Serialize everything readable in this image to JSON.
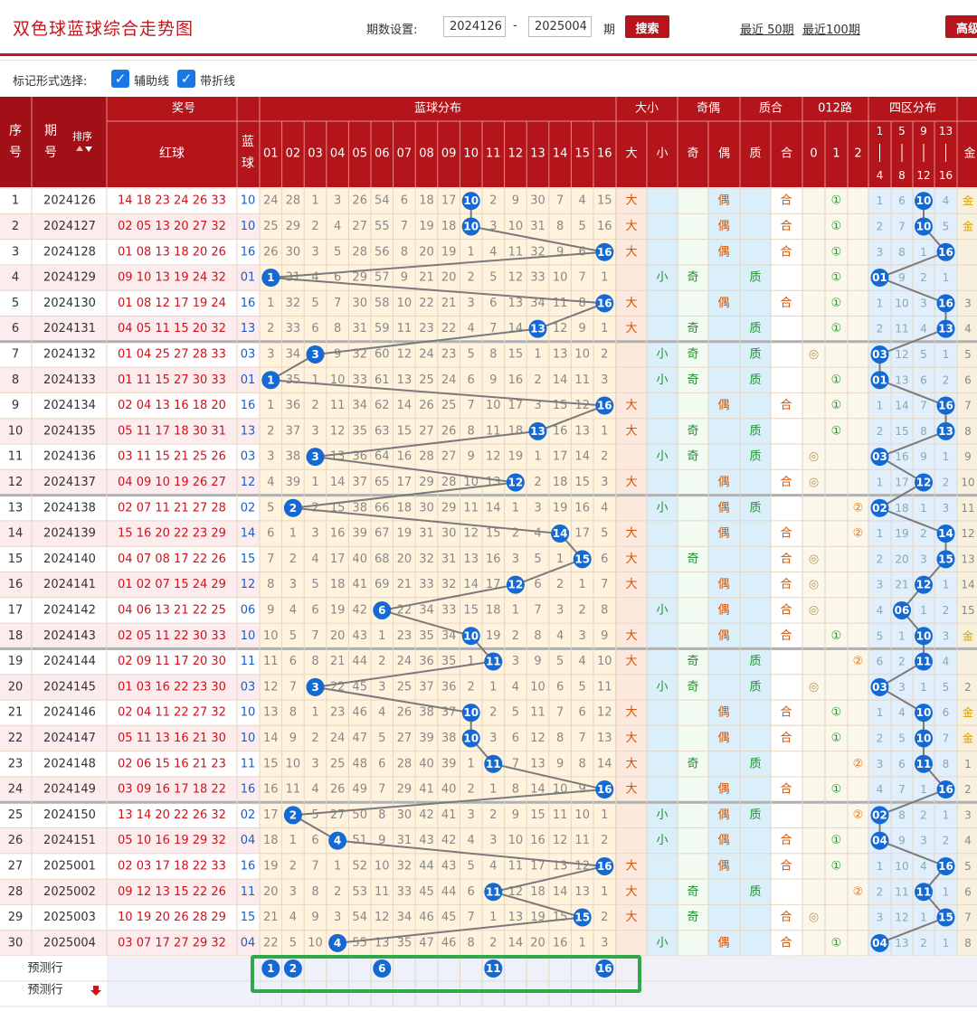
{
  "header": {
    "title": "双色球蓝球综合走势图",
    "period_label": "期数设置:",
    "period_from": "2024126",
    "period_dash": "-",
    "period_to": "2025004",
    "period_unit": "期",
    "search_label": "搜索",
    "recent_50_label": "最近 50期",
    "recent_100_label": "最近100期",
    "advanced_label": "高级"
  },
  "options": {
    "label": "标记形式选择:",
    "aux_line_label": "辅助线",
    "fold_line_label": "带折线",
    "aux_line_checked": true,
    "fold_line_checked": true
  },
  "table": {
    "col_seq": "序号",
    "col_issue": "期号",
    "sort_label": "排序",
    "group_prize": "奖号",
    "col_red": "红球",
    "col_blue": "蓝球",
    "group_blue_dist": "蓝球分布",
    "blue_numbers": [
      "01",
      "02",
      "03",
      "04",
      "05",
      "06",
      "07",
      "08",
      "09",
      "10",
      "11",
      "12",
      "13",
      "14",
      "15",
      "16"
    ],
    "group_size": "大小",
    "size_labels": [
      "大",
      "小"
    ],
    "group_parity": "奇偶",
    "parity_labels": [
      "奇",
      "偶"
    ],
    "group_prime": "质合",
    "prime_labels": [
      "质",
      "合"
    ],
    "group_mod3": "012路",
    "mod3_labels": [
      "0",
      "1",
      "2"
    ],
    "group_zone": "四区分布",
    "zone_labels": [
      "1|4",
      "5|8",
      "9|12",
      "13|16"
    ],
    "col_extra_partial": "金",
    "mod3_marks": [
      "◎",
      "①",
      "②"
    ],
    "rows": [
      {
        "seq": "1",
        "issue": "2024126",
        "red": "14 18 23 24 26 33",
        "blue": "10",
        "dist": [
          24,
          28,
          1,
          3,
          26,
          54,
          6,
          18,
          17,
          0,
          2,
          9,
          30,
          7,
          4,
          15
        ],
        "size": "大",
        "parity": "偶",
        "prime": "合",
        "mod3": 1,
        "zone": [
          1,
          6,
          0,
          4
        ],
        "extra": "金"
      },
      {
        "seq": "2",
        "issue": "2024127",
        "red": "02 05 13 20 27 32",
        "blue": "10",
        "dist": [
          25,
          29,
          2,
          4,
          27,
          55,
          7,
          19,
          18,
          0,
          3,
          10,
          31,
          8,
          5,
          16
        ],
        "size": "大",
        "parity": "偶",
        "prime": "合",
        "mod3": 1,
        "zone": [
          2,
          7,
          0,
          5
        ],
        "extra": "金"
      },
      {
        "seq": "3",
        "issue": "2024128",
        "red": "01 08 13 18 20 26",
        "blue": "16",
        "dist": [
          26,
          30,
          3,
          5,
          28,
          56,
          8,
          20,
          19,
          1,
          4,
          11,
          32,
          9,
          6,
          0
        ],
        "size": "大",
        "parity": "偶",
        "prime": "合",
        "mod3": 1,
        "zone": [
          3,
          8,
          1,
          0
        ],
        "extra": ""
      },
      {
        "seq": "4",
        "issue": "2024129",
        "red": "09 10 13 19 24 32",
        "blue": "01",
        "dist": [
          0,
          31,
          4,
          6,
          29,
          57,
          9,
          21,
          20,
          2,
          5,
          12,
          33,
          10,
          7,
          1
        ],
        "size": "小",
        "parity": "奇",
        "prime": "质",
        "mod3": 1,
        "zone": [
          0,
          9,
          2,
          1
        ],
        "extra": ""
      },
      {
        "seq": "5",
        "issue": "2024130",
        "red": "01 08 12 17 19 24",
        "blue": "16",
        "dist": [
          1,
          32,
          5,
          7,
          30,
          58,
          10,
          22,
          21,
          3,
          6,
          13,
          34,
          11,
          8,
          0
        ],
        "size": "大",
        "parity": "偶",
        "prime": "合",
        "mod3": 1,
        "zone": [
          1,
          10,
          3,
          0
        ],
        "extra": "3"
      },
      {
        "seq": "6",
        "issue": "2024131",
        "red": "04 05 11 15 20 32",
        "blue": "13",
        "dist": [
          2,
          33,
          6,
          8,
          31,
          59,
          11,
          23,
          22,
          4,
          7,
          14,
          0,
          12,
          9,
          1
        ],
        "size": "大",
        "parity": "奇",
        "prime": "质",
        "mod3": 1,
        "zone": [
          2,
          11,
          4,
          0
        ],
        "extra": "4"
      },
      {
        "seq": "7",
        "issue": "2024132",
        "red": "01 04 25 27 28 33",
        "blue": "03",
        "dist": [
          3,
          34,
          0,
          9,
          32,
          60,
          12,
          24,
          23,
          5,
          8,
          15,
          1,
          13,
          10,
          2
        ],
        "size": "小",
        "parity": "奇",
        "prime": "质",
        "mod3": 0,
        "zone": [
          0,
          12,
          5,
          1
        ],
        "extra": "5"
      },
      {
        "seq": "8",
        "issue": "2024133",
        "red": "01 11 15 27 30 33",
        "blue": "01",
        "dist": [
          0,
          35,
          1,
          10,
          33,
          61,
          13,
          25,
          24,
          6,
          9,
          16,
          2,
          14,
          11,
          3
        ],
        "size": "小",
        "parity": "奇",
        "prime": "质",
        "mod3": 1,
        "zone": [
          0,
          13,
          6,
          2
        ],
        "extra": "6"
      },
      {
        "seq": "9",
        "issue": "2024134",
        "red": "02 04 13 16 18 20",
        "blue": "16",
        "dist": [
          1,
          36,
          2,
          11,
          34,
          62,
          14,
          26,
          25,
          7,
          10,
          17,
          3,
          15,
          12,
          0
        ],
        "size": "大",
        "parity": "偶",
        "prime": "合",
        "mod3": 1,
        "zone": [
          1,
          14,
          7,
          0
        ],
        "extra": "7"
      },
      {
        "seq": "10",
        "issue": "2024135",
        "red": "05 11 17 18 30 31",
        "blue": "13",
        "dist": [
          2,
          37,
          3,
          12,
          35,
          63,
          15,
          27,
          26,
          8,
          11,
          18,
          0,
          16,
          13,
          1
        ],
        "size": "大",
        "parity": "奇",
        "prime": "质",
        "mod3": 1,
        "zone": [
          2,
          15,
          8,
          0
        ],
        "extra": "8"
      },
      {
        "seq": "11",
        "issue": "2024136",
        "red": "03 11 15 21 25 26",
        "blue": "03",
        "dist": [
          3,
          38,
          0,
          13,
          36,
          64,
          16,
          28,
          27,
          9,
          12,
          19,
          1,
          17,
          14,
          2
        ],
        "size": "小",
        "parity": "奇",
        "prime": "质",
        "mod3": 0,
        "zone": [
          0,
          16,
          9,
          1
        ],
        "extra": "9"
      },
      {
        "seq": "12",
        "issue": "2024137",
        "red": "04 09 10 19 26 27",
        "blue": "12",
        "dist": [
          4,
          39,
          1,
          14,
          37,
          65,
          17,
          29,
          28,
          10,
          13,
          0,
          2,
          18,
          15,
          3
        ],
        "size": "大",
        "parity": "偶",
        "prime": "合",
        "mod3": 0,
        "zone": [
          1,
          17,
          0,
          2
        ],
        "extra": "10"
      },
      {
        "seq": "13",
        "issue": "2024138",
        "red": "02 07 11 21 27 28",
        "blue": "02",
        "dist": [
          5,
          0,
          2,
          15,
          38,
          66,
          18,
          30,
          29,
          11,
          14,
          1,
          3,
          19,
          16,
          4
        ],
        "size": "小",
        "parity": "偶",
        "prime": "质",
        "mod3": 2,
        "zone": [
          0,
          18,
          1,
          3
        ],
        "extra": "11"
      },
      {
        "seq": "14",
        "issue": "2024139",
        "red": "15 16 20 22 23 29",
        "blue": "14",
        "dist": [
          6,
          1,
          3,
          16,
          39,
          67,
          19,
          31,
          30,
          12,
          15,
          2,
          4,
          0,
          17,
          5
        ],
        "size": "大",
        "parity": "偶",
        "prime": "合",
        "mod3": 2,
        "zone": [
          1,
          19,
          2,
          0
        ],
        "extra": "12"
      },
      {
        "seq": "15",
        "issue": "2024140",
        "red": "04 07 08 17 22 26",
        "blue": "15",
        "dist": [
          7,
          2,
          4,
          17,
          40,
          68,
          20,
          32,
          31,
          13,
          16,
          3,
          5,
          1,
          0,
          6
        ],
        "size": "大",
        "parity": "奇",
        "prime": "合",
        "mod3": 0,
        "zone": [
          2,
          20,
          3,
          0
        ],
        "extra": "13"
      },
      {
        "seq": "16",
        "issue": "2024141",
        "red": "01 02 07 15 24 29",
        "blue": "12",
        "dist": [
          8,
          3,
          5,
          18,
          41,
          69,
          21,
          33,
          32,
          14,
          17,
          0,
          6,
          2,
          1,
          7
        ],
        "size": "大",
        "parity": "偶",
        "prime": "合",
        "mod3": 0,
        "zone": [
          3,
          21,
          0,
          1
        ],
        "extra": "14"
      },
      {
        "seq": "17",
        "issue": "2024142",
        "red": "04 06 13 21 22 25",
        "blue": "06",
        "dist": [
          9,
          4,
          6,
          19,
          42,
          0,
          22,
          34,
          33,
          15,
          18,
          1,
          7,
          3,
          2,
          8
        ],
        "size": "小",
        "parity": "偶",
        "prime": "合",
        "mod3": 0,
        "zone": [
          4,
          0,
          1,
          2
        ],
        "extra": "15"
      },
      {
        "seq": "18",
        "issue": "2024143",
        "red": "02 05 11 22 30 33",
        "blue": "10",
        "dist": [
          10,
          5,
          7,
          20,
          43,
          1,
          23,
          35,
          34,
          0,
          19,
          2,
          8,
          4,
          3,
          9
        ],
        "size": "大",
        "parity": "偶",
        "prime": "合",
        "mod3": 1,
        "zone": [
          5,
          1,
          0,
          3
        ],
        "extra": "金"
      },
      {
        "seq": "19",
        "issue": "2024144",
        "red": "02 09 11 17 20 30",
        "blue": "11",
        "dist": [
          11,
          6,
          8,
          21,
          44,
          2,
          24,
          36,
          35,
          1,
          0,
          3,
          9,
          5,
          4,
          10
        ],
        "size": "大",
        "parity": "奇",
        "prime": "质",
        "mod3": 2,
        "zone": [
          6,
          2,
          0,
          4
        ],
        "extra": ""
      },
      {
        "seq": "20",
        "issue": "2024145",
        "red": "01 03 16 22 23 30",
        "blue": "03",
        "dist": [
          12,
          7,
          0,
          22,
          45,
          3,
          25,
          37,
          36,
          2,
          1,
          4,
          10,
          6,
          5,
          11
        ],
        "size": "小",
        "parity": "奇",
        "prime": "质",
        "mod3": 0,
        "zone": [
          0,
          3,
          1,
          5
        ],
        "extra": "2"
      },
      {
        "seq": "21",
        "issue": "2024146",
        "red": "02 04 11 22 27 32",
        "blue": "10",
        "dist": [
          13,
          8,
          1,
          23,
          46,
          4,
          26,
          38,
          37,
          0,
          2,
          5,
          11,
          7,
          6,
          12
        ],
        "size": "大",
        "parity": "偶",
        "prime": "合",
        "mod3": 1,
        "zone": [
          1,
          4,
          0,
          6
        ],
        "extra": "金"
      },
      {
        "seq": "22",
        "issue": "2024147",
        "red": "05 11 13 16 21 30",
        "blue": "10",
        "dist": [
          14,
          9,
          2,
          24,
          47,
          5,
          27,
          39,
          38,
          0,
          3,
          6,
          12,
          8,
          7,
          13
        ],
        "size": "大",
        "parity": "偶",
        "prime": "合",
        "mod3": 1,
        "zone": [
          2,
          5,
          0,
          7
        ],
        "extra": "金"
      },
      {
        "seq": "23",
        "issue": "2024148",
        "red": "02 06 15 16 21 23",
        "blue": "11",
        "dist": [
          15,
          10,
          3,
          25,
          48,
          6,
          28,
          40,
          39,
          1,
          0,
          7,
          13,
          9,
          8,
          14
        ],
        "size": "大",
        "parity": "奇",
        "prime": "质",
        "mod3": 2,
        "zone": [
          3,
          6,
          0,
          8
        ],
        "extra": "1"
      },
      {
        "seq": "24",
        "issue": "2024149",
        "red": "03 09 16 17 18 22",
        "blue": "16",
        "dist": [
          16,
          11,
          4,
          26,
          49,
          7,
          29,
          41,
          40,
          2,
          1,
          8,
          14,
          10,
          9,
          0
        ],
        "size": "大",
        "parity": "偶",
        "prime": "合",
        "mod3": 1,
        "zone": [
          4,
          7,
          1,
          0
        ],
        "extra": "2"
      },
      {
        "seq": "25",
        "issue": "2024150",
        "red": "13 14 20 22 26 32",
        "blue": "02",
        "dist": [
          17,
          0,
          5,
          27,
          50,
          8,
          30,
          42,
          41,
          3,
          2,
          9,
          15,
          11,
          10,
          1
        ],
        "size": "小",
        "parity": "偶",
        "prime": "质",
        "mod3": 2,
        "zone": [
          0,
          8,
          2,
          1
        ],
        "extra": "3"
      },
      {
        "seq": "26",
        "issue": "2024151",
        "red": "05 10 16 19 29 32",
        "blue": "04",
        "dist": [
          18,
          1,
          6,
          0,
          51,
          9,
          31,
          43,
          42,
          4,
          3,
          10,
          16,
          12,
          11,
          2
        ],
        "size": "小",
        "parity": "偶",
        "prime": "合",
        "mod3": 1,
        "zone": [
          0,
          9,
          3,
          2
        ],
        "extra": "4"
      },
      {
        "seq": "27",
        "issue": "2025001",
        "red": "02 03 17 18 22 33",
        "blue": "16",
        "dist": [
          19,
          2,
          7,
          1,
          52,
          10,
          32,
          44,
          43,
          5,
          4,
          11,
          17,
          13,
          12,
          0
        ],
        "size": "大",
        "parity": "偶",
        "prime": "合",
        "mod3": 1,
        "zone": [
          1,
          10,
          4,
          0
        ],
        "extra": "5"
      },
      {
        "seq": "28",
        "issue": "2025002",
        "red": "09 12 13 15 22 26",
        "blue": "11",
        "dist": [
          20,
          3,
          8,
          2,
          53,
          11,
          33,
          45,
          44,
          6,
          0,
          12,
          18,
          14,
          13,
          1
        ],
        "size": "大",
        "parity": "奇",
        "prime": "质",
        "mod3": 2,
        "zone": [
          2,
          11,
          0,
          1
        ],
        "extra": "6"
      },
      {
        "seq": "29",
        "issue": "2025003",
        "red": "10 19 20 26 28 29",
        "blue": "15",
        "dist": [
          21,
          4,
          9,
          3,
          54,
          12,
          34,
          46,
          45,
          7,
          1,
          13,
          19,
          15,
          0,
          2
        ],
        "size": "大",
        "parity": "奇",
        "prime": "合",
        "mod3": 0,
        "zone": [
          3,
          12,
          1,
          0
        ],
        "extra": "7"
      },
      {
        "seq": "30",
        "issue": "2025004",
        "red": "03 07 17 27 29 32",
        "blue": "04",
        "dist": [
          22,
          5,
          10,
          0,
          55,
          13,
          35,
          47,
          46,
          8,
          2,
          14,
          20,
          16,
          1,
          3
        ],
        "size": "小",
        "parity": "偶",
        "prime": "合",
        "mod3": 1,
        "zone": [
          0,
          13,
          2,
          1
        ],
        "extra": "8"
      }
    ],
    "predict_label_1": "预测行",
    "predict_label_2": "预测行",
    "predict_balls": [
      1,
      2,
      6,
      11,
      16
    ]
  },
  "colors": {
    "brand_red": "#c4161c",
    "header_red": "#b3151b",
    "ball_blue": "#1569d2",
    "highlight_green": "#2fa84a",
    "size_big": "#d35400",
    "small_green": "#1e8f2e"
  }
}
